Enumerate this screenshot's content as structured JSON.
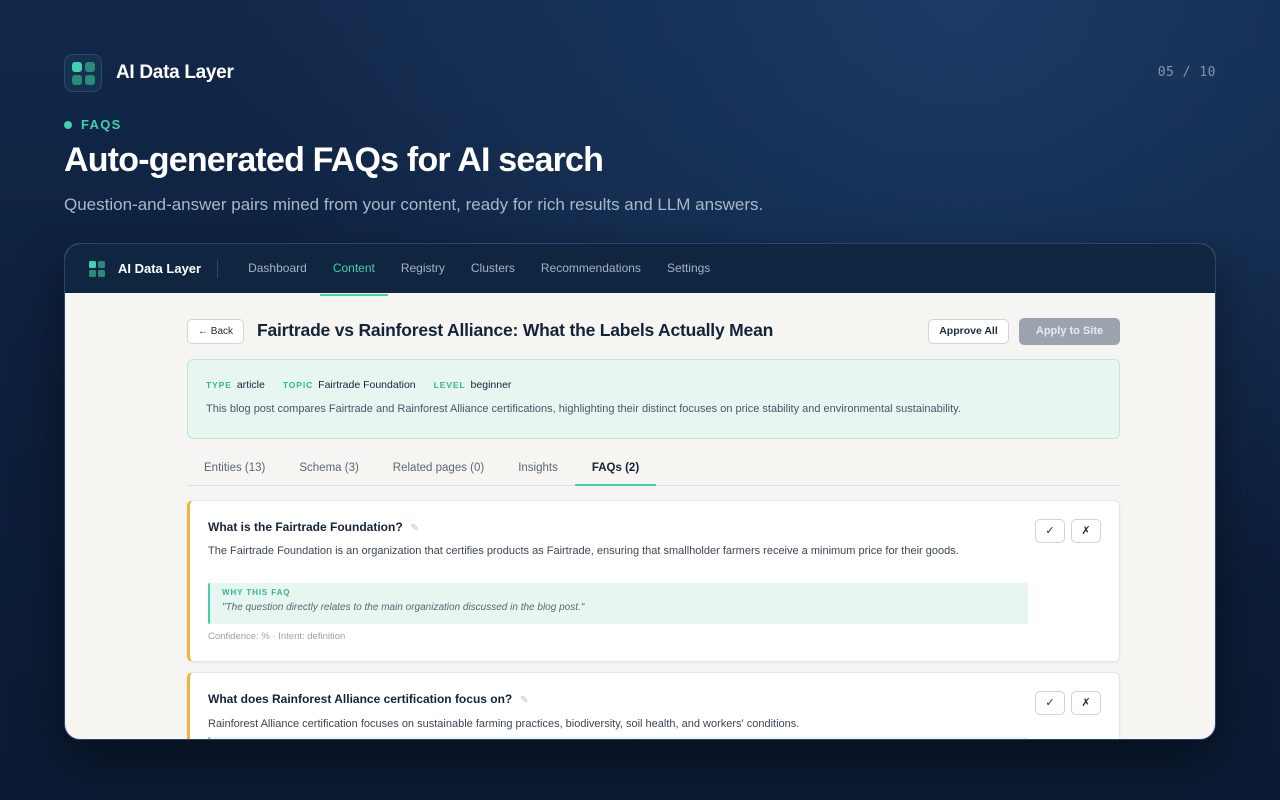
{
  "brand": {
    "name": "AI Data Layer"
  },
  "pager": "05 / 10",
  "eyebrow": "FAQS",
  "headline": "Auto-generated FAQs for AI search",
  "subhead": "Question-and-answer pairs mined from your content, ready for rich results and LLM answers.",
  "app": {
    "name": "AI Data Layer",
    "nav": [
      "Dashboard",
      "Content",
      "Registry",
      "Clusters",
      "Recommendations",
      "Settings"
    ],
    "active_nav": "Content"
  },
  "page": {
    "back_label": "← Back",
    "title": "Fairtrade vs Rainforest Alliance: What the Labels Actually Mean",
    "approve_all_label": "Approve All",
    "apply_label": "Apply to Site"
  },
  "meta": {
    "type_key": "TYPE",
    "type_value": "article",
    "topic_key": "TOPIC",
    "topic_value": "Fairtrade Foundation",
    "level_key": "LEVEL",
    "level_value": "beginner",
    "description": "This blog post compares Fairtrade and Rainforest Alliance certifications, highlighting their distinct focuses on price stability and environmental sustainability."
  },
  "tabs": [
    "Entities (13)",
    "Schema (3)",
    "Related pages (0)",
    "Insights",
    "FAQs (2)"
  ],
  "active_tab": "FAQs (2)",
  "faqs": [
    {
      "question": "What is the Fairtrade Foundation?",
      "answer": "The Fairtrade Foundation is an organization that certifies products as Fairtrade, ensuring that smallholder farmers receive a minimum price for their goods.",
      "why_label": "WHY THIS FAQ",
      "why_text": "\"The question directly relates to the main organization discussed in the blog post.\"",
      "footer": "Confidence: % · Intent: definition",
      "approve": "✓",
      "reject": "✗"
    },
    {
      "question": "What does Rainforest Alliance certification focus on?",
      "answer": "Rainforest Alliance certification focuses on sustainable farming practices, biodiversity, soil health, and workers' conditions.",
      "approve": "✓",
      "reject": "✗"
    }
  ],
  "icons": {
    "edit": "✎",
    "approve": "check-icon",
    "reject": "x-icon"
  },
  "colors": {
    "accent": "#3fd1b0",
    "warning_border": "#f0b43c",
    "navy": "#102640"
  }
}
